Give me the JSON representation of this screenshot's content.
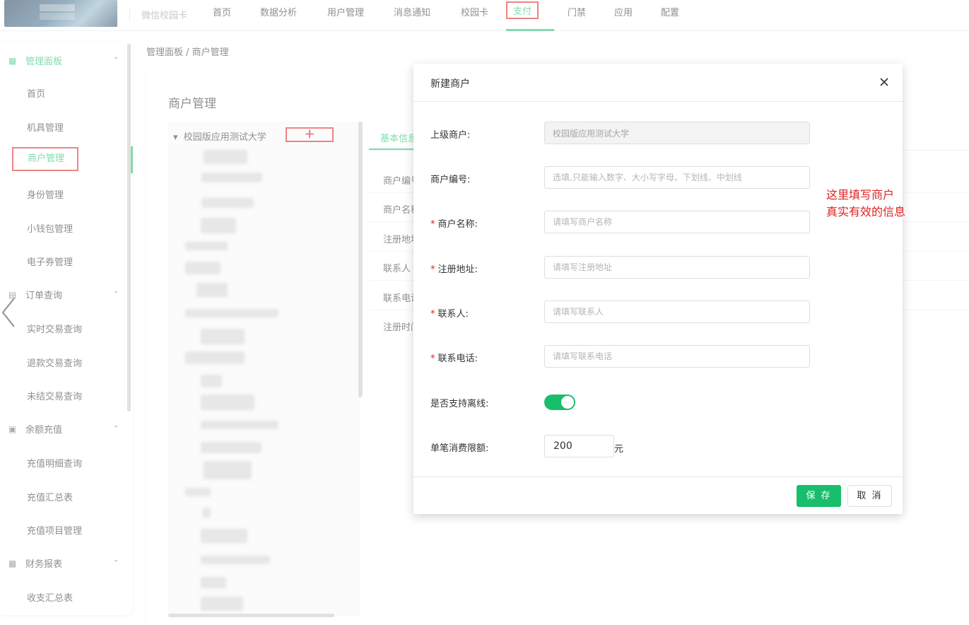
{
  "topnav": {
    "brand": "微信校园卡",
    "items": [
      "首页",
      "数据分析",
      "用户管理",
      "消息通知",
      "校园卡",
      "支付",
      "门禁",
      "应用",
      "配置"
    ],
    "active": "支付"
  },
  "sidebar": {
    "groups": [
      {
        "label": "管理面板",
        "icon": "grid-icon",
        "items": [
          "首页",
          "机具管理",
          "商户管理",
          "身份管理",
          "小钱包管理",
          "电子券管理"
        ]
      },
      {
        "label": "订单查询",
        "icon": "order-icon",
        "items": [
          "实时交易查询",
          "退款交易查询",
          "未结交易查询"
        ]
      },
      {
        "label": "余额充值",
        "icon": "wallet-icon",
        "items": [
          "充值明细查询",
          "充值汇总表",
          "充值项目管理"
        ]
      },
      {
        "label": "财务报表",
        "icon": "table-icon",
        "items": [
          "收支汇总表"
        ]
      }
    ],
    "active_item": "商户管理"
  },
  "breadcrumb": "管理面板 / 商户管理",
  "page_title": "商户管理",
  "tree": {
    "root": "校园版应用测试大学",
    "add_symbol": "+"
  },
  "tab": {
    "label": "基本信息"
  },
  "bg_form_labels": [
    "商户编号",
    "商户名称",
    "注册地址",
    "联系人",
    "联系电话",
    "注册时间"
  ],
  "modal": {
    "title": "新建商户",
    "fields": {
      "parent": {
        "label": "上级商户:",
        "value": "校园版应用测试大学"
      },
      "code": {
        "label": "商户编号:",
        "placeholder": "选填,只能输入数字、大小写字母、下划线、中划线"
      },
      "name": {
        "label": "商户名称:",
        "placeholder": "请填写商户名称",
        "required": "*"
      },
      "address": {
        "label": "注册地址:",
        "placeholder": "请填写注册地址",
        "required": "*"
      },
      "contact": {
        "label": "联系人:",
        "placeholder": "请填写联系人",
        "required": "*"
      },
      "phone": {
        "label": "联系电话:",
        "placeholder": "请填写联系电话",
        "required": "*"
      },
      "offline": {
        "label": "是否支持离线:",
        "enabled": true
      },
      "limit": {
        "label": "单笔消费限额:",
        "value": "200",
        "unit": "元"
      }
    },
    "save": "保 存",
    "cancel": "取 消"
  },
  "annotation": {
    "line1": "这里填写商户",
    "line2": "真实有效的信息"
  },
  "colors": {
    "accent": "#19be6b",
    "highlight": "#e02020"
  }
}
